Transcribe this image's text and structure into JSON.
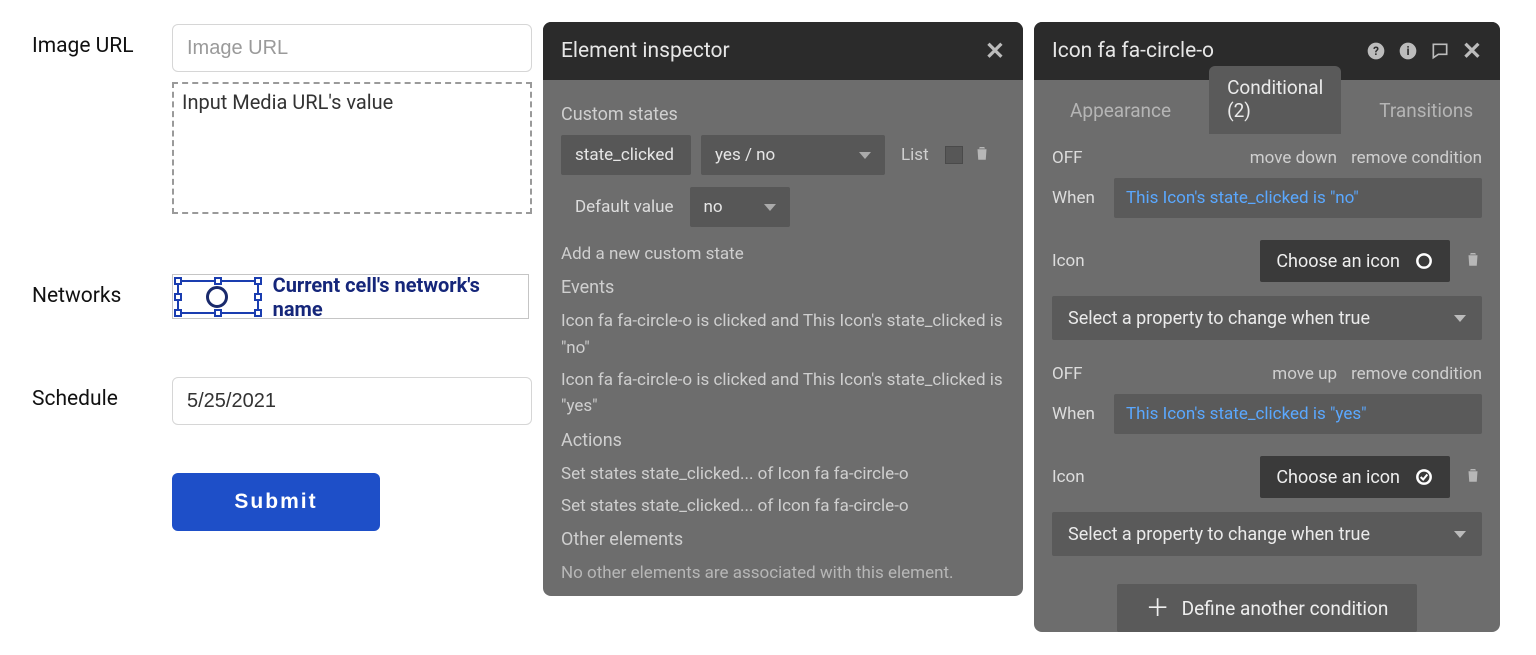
{
  "form": {
    "image_url_label": "Image URL",
    "image_url_placeholder": "Image URL",
    "media_dashed_text": "Input Media URL's value",
    "networks_label": "Networks",
    "networks_cell_text": "Current cell's network's name",
    "schedule_label": "Schedule",
    "schedule_value": "5/25/2021",
    "submit_label": "Submit"
  },
  "inspector": {
    "title": "Element inspector",
    "sections": {
      "custom_states_title": "Custom states",
      "state_name": "state_clicked",
      "state_type": "yes / no",
      "list_label": "List",
      "default_label": "Default value",
      "default_value": "no",
      "add_state": "Add a new custom state",
      "events_title": "Events",
      "event1": "Icon fa fa-circle-o is clicked and This Icon's state_clicked is \"no\"",
      "event2": "Icon fa fa-circle-o is clicked and This Icon's state_clicked is \"yes\"",
      "actions_title": "Actions",
      "action1": "Set states state_clicked... of Icon fa fa-circle-o",
      "action2": "Set states state_clicked... of Icon fa fa-circle-o",
      "other_title": "Other elements",
      "other_text": "No other elements are associated with this element."
    }
  },
  "props": {
    "title": "Icon fa fa-circle-o",
    "tabs": {
      "appearance": "Appearance",
      "conditional": "Conditional (2)",
      "transitions": "Transitions"
    },
    "cond1": {
      "off": "OFF",
      "move": "move down",
      "remove": "remove condition",
      "when_label": "When",
      "when_expr": "This Icon's state_clicked is \"no\"",
      "icon_label": "Icon",
      "choose": "Choose an icon",
      "select_prop": "Select a property to change when true"
    },
    "cond2": {
      "off": "OFF",
      "move": "move up",
      "remove": "remove condition",
      "when_label": "When",
      "when_expr": "This Icon's state_clicked is \"yes\"",
      "icon_label": "Icon",
      "choose": "Choose an icon",
      "select_prop": "Select a property to change when true"
    },
    "define_another": "Define another condition"
  }
}
